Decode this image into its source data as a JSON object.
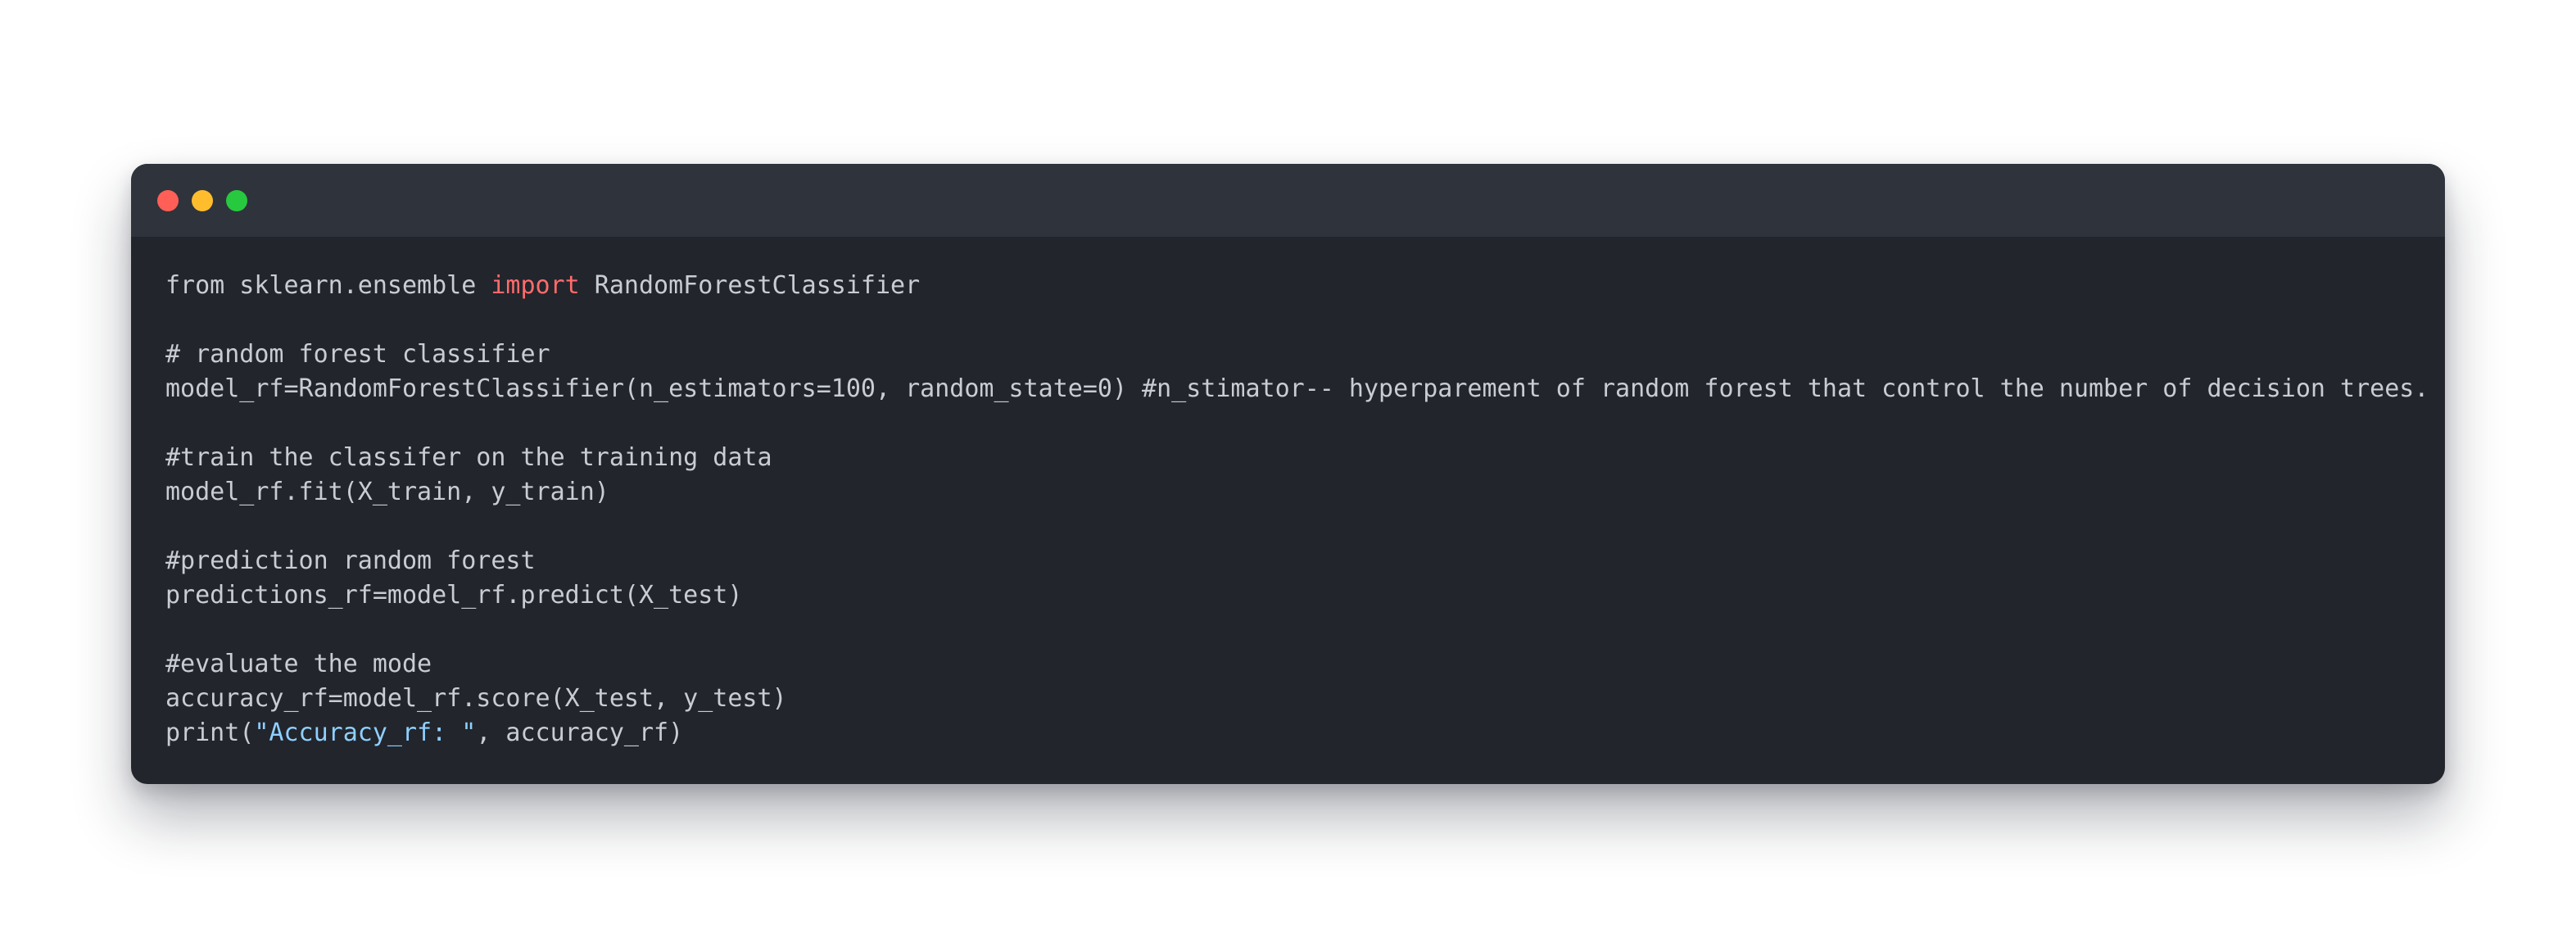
{
  "window": {
    "controls": [
      "close",
      "minimize",
      "maximize"
    ]
  },
  "code": {
    "lines": [
      [
        {
          "t": "from sklearn.ensemble "
        },
        {
          "t": "import",
          "k": "kw"
        },
        {
          "t": " RandomForestClassifier"
        }
      ],
      [
        {
          "t": ""
        }
      ],
      [
        {
          "t": "# random forest classifier"
        }
      ],
      [
        {
          "t": "model_rf=RandomForestClassifier(n_estimators=100, random_state=0) #n_stimator-- hyperparement of random forest that control the number of decision trees."
        }
      ],
      [
        {
          "t": ""
        }
      ],
      [
        {
          "t": "#train the classifer on the training data"
        }
      ],
      [
        {
          "t": "model_rf.fit(X_train, y_train)"
        }
      ],
      [
        {
          "t": ""
        }
      ],
      [
        {
          "t": "#prediction random forest"
        }
      ],
      [
        {
          "t": "predictions_rf=model_rf.predict(X_test)"
        }
      ],
      [
        {
          "t": ""
        }
      ],
      [
        {
          "t": "#evaluate the mode"
        }
      ],
      [
        {
          "t": "accuracy_rf=model_rf.score(X_test, y_test)"
        }
      ],
      [
        {
          "t": "print("
        },
        {
          "t": "\"Accuracy_rf: \"",
          "k": "str"
        },
        {
          "t": ", accuracy_rf)"
        }
      ]
    ]
  },
  "colors": {
    "background": "#ffffff",
    "window": "#22252c",
    "titlebar": "#2f333b",
    "text": "#c9ccd3",
    "keyword": "#ff6b6b",
    "string": "#8fd0ff",
    "close": "#ff5f56",
    "minimize": "#ffbd2e",
    "maximize": "#27c93f"
  }
}
